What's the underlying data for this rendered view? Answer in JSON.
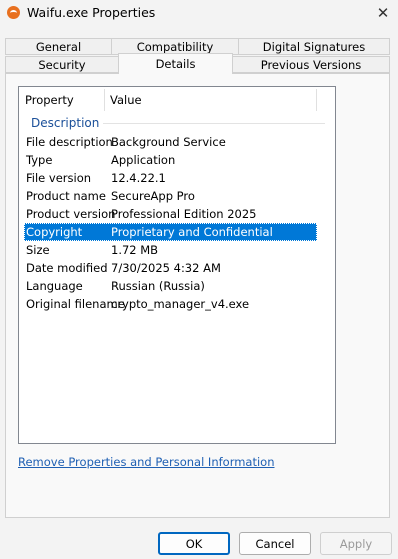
{
  "window": {
    "title": "Waifu.exe Properties",
    "close_glyph": "✕"
  },
  "tabs": {
    "row1": [
      "General",
      "Compatibility",
      "Digital Signatures"
    ],
    "row2": [
      "Security",
      "Details",
      "Previous Versions"
    ],
    "active": "Details"
  },
  "details": {
    "columns": {
      "property": "Property",
      "value": "Value"
    },
    "group": "Description",
    "rows": [
      {
        "name": "File description",
        "value": "Background Service"
      },
      {
        "name": "Type",
        "value": "Application"
      },
      {
        "name": "File version",
        "value": "12.4.22.1"
      },
      {
        "name": "Product name",
        "value": "SecureApp Pro"
      },
      {
        "name": "Product version",
        "value": "Professional Edition 2025"
      },
      {
        "name": "Copyright",
        "value": "Proprietary and Confidential",
        "selected": true
      },
      {
        "name": "Size",
        "value": "1.72 MB"
      },
      {
        "name": "Date modified",
        "value": "7/30/2025 4:32 AM"
      },
      {
        "name": "Language",
        "value": "Russian (Russia)"
      },
      {
        "name": "Original filename",
        "value": "crypto_manager_v4.exe"
      }
    ]
  },
  "remove_link": "Remove Properties and Personal Information",
  "buttons": {
    "ok": "OK",
    "cancel": "Cancel",
    "apply": "Apply"
  },
  "colors": {
    "selection": "#0078d7",
    "link": "#1e5fb3",
    "group": "#1a4f99",
    "app_icon": "#e8701f"
  }
}
